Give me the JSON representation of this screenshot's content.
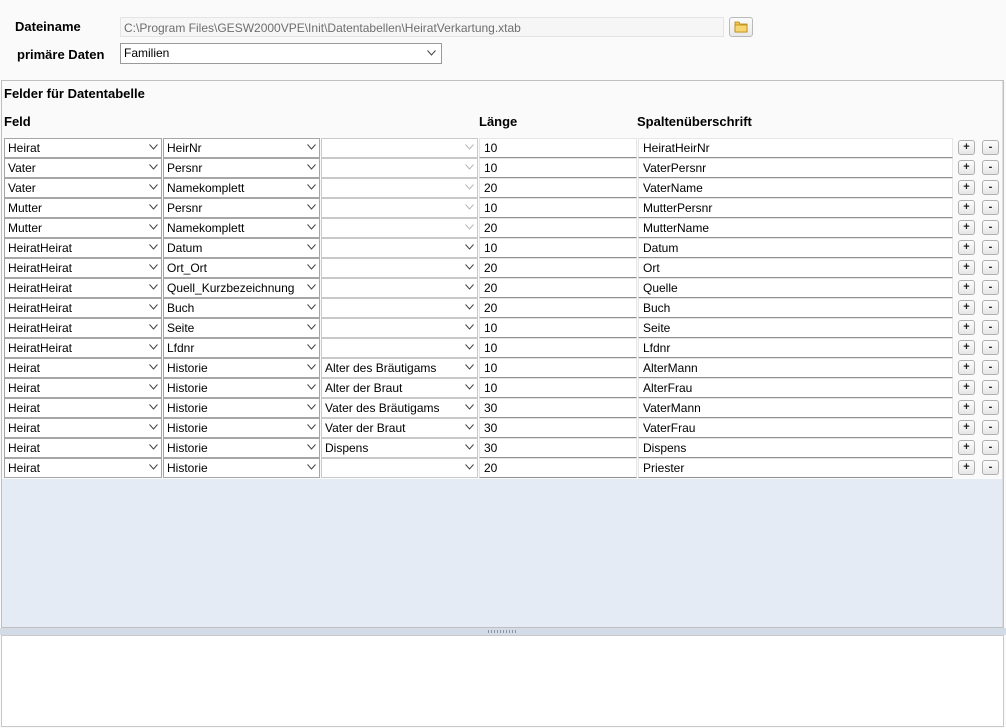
{
  "header": {
    "filename_label": "Dateiname",
    "filename_value": "C:\\Program Files\\GESW2000VPE\\Init\\Datentabellen\\HeiratVerkartung.xtab",
    "folder_icon": "folder-icon",
    "primary_label": "primäre Daten",
    "primary_value": "Familien"
  },
  "panel": {
    "title": "Felder für Datentabelle",
    "col_feld": "Feld",
    "col_laenge": "Länge",
    "col_spalten": "Spaltenüberschrift",
    "plus_label": "+",
    "minus_label": "-"
  },
  "rows": [
    {
      "f1": "Heirat",
      "f2": "HeirNr",
      "f3": "",
      "len": "10",
      "head": "HeiratHeirNr",
      "f3_enabled": false
    },
    {
      "f1": "Vater",
      "f2": "Persnr",
      "f3": "",
      "len": "10",
      "head": "VaterPersnr",
      "f3_enabled": false
    },
    {
      "f1": "Vater",
      "f2": "Namekomplett",
      "f3": "",
      "len": "20",
      "head": "VaterName",
      "f3_enabled": false
    },
    {
      "f1": "Mutter",
      "f2": "Persnr",
      "f3": "",
      "len": "10",
      "head": "MutterPersnr",
      "f3_enabled": false
    },
    {
      "f1": "Mutter",
      "f2": "Namekomplett",
      "f3": "",
      "len": "20",
      "head": "MutterName",
      "f3_enabled": false
    },
    {
      "f1": "HeiratHeirat",
      "f2": "Datum",
      "f3": "",
      "len": "10",
      "head": "Datum",
      "f3_enabled": true
    },
    {
      "f1": "HeiratHeirat",
      "f2": "Ort_Ort",
      "f3": "",
      "len": "20",
      "head": "Ort",
      "f3_enabled": true
    },
    {
      "f1": "HeiratHeirat",
      "f2": "Quell_Kurzbezeichnung",
      "f3": "",
      "len": "20",
      "head": "Quelle",
      "f3_enabled": true
    },
    {
      "f1": "HeiratHeirat",
      "f2": "Buch",
      "f3": "",
      "len": "20",
      "head": "Buch",
      "f3_enabled": true
    },
    {
      "f1": "HeiratHeirat",
      "f2": "Seite",
      "f3": "",
      "len": "10",
      "head": "Seite",
      "f3_enabled": true
    },
    {
      "f1": "HeiratHeirat",
      "f2": "Lfdnr",
      "f3": "",
      "len": "10",
      "head": "Lfdnr",
      "f3_enabled": true
    },
    {
      "f1": "Heirat",
      "f2": "Historie",
      "f3": "Alter des Bräutigams",
      "len": "10",
      "head": "AlterMann",
      "f3_enabled": true
    },
    {
      "f1": "Heirat",
      "f2": "Historie",
      "f3": "Alter der Braut",
      "len": "10",
      "head": "AlterFrau",
      "f3_enabled": true
    },
    {
      "f1": "Heirat",
      "f2": "Historie",
      "f3": "Vater des Bräutigams",
      "len": "30",
      "head": "VaterMann",
      "f3_enabled": true
    },
    {
      "f1": "Heirat",
      "f2": "Historie",
      "f3": "Vater der Braut",
      "len": "30",
      "head": "VaterFrau",
      "f3_enabled": true
    },
    {
      "f1": "Heirat",
      "f2": "Historie",
      "f3": "Dispens",
      "len": "30",
      "head": "Dispens",
      "f3_enabled": true
    },
    {
      "f1": "Heirat",
      "f2": "Historie",
      "f3": "",
      "len": "20",
      "head": "Priester",
      "f3_enabled": true
    }
  ]
}
